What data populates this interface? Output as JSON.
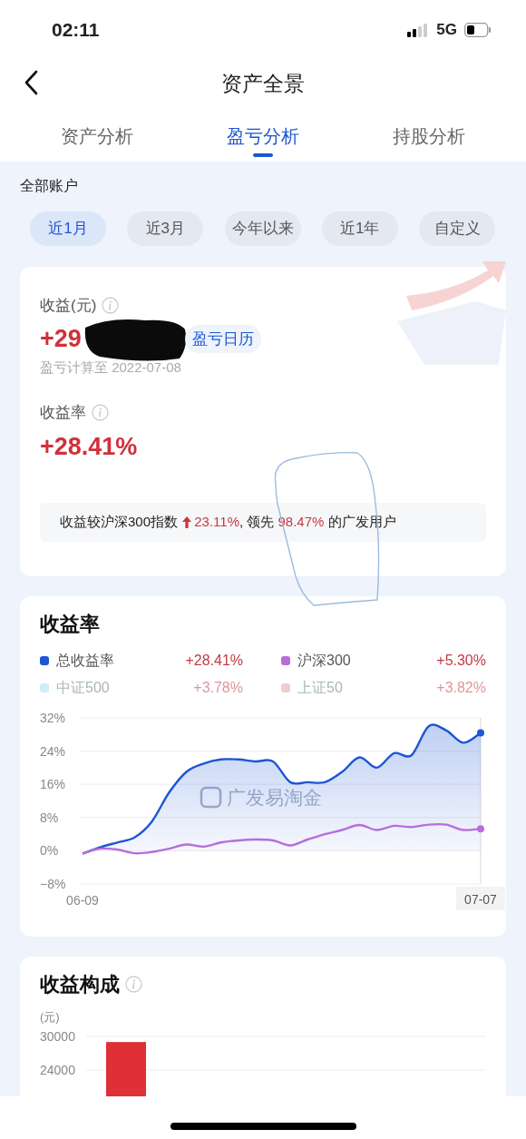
{
  "status_bar": {
    "time": "02:11",
    "network": "5G"
  },
  "header": {
    "title": "资产全景"
  },
  "tabs": [
    {
      "label": "资产分析",
      "selected": false
    },
    {
      "label": "盈亏分析",
      "selected": true
    },
    {
      "label": "持股分析",
      "selected": false
    }
  ],
  "account": "全部账户",
  "periods": [
    {
      "label": "近1月",
      "selected": true
    },
    {
      "label": "近3月",
      "selected": false
    },
    {
      "label": "今年以来",
      "selected": false
    },
    {
      "label": "近1年",
      "selected": false
    },
    {
      "label": "自定义",
      "selected": false
    }
  ],
  "summary": {
    "profit_label": "收益(元)",
    "profit_value": "+29",
    "redacted": true,
    "calendar_button": "盈亏日历",
    "as_of": "盈亏计算至 2022-07-08",
    "rate_label": "收益率",
    "rate_value": "+28.41%",
    "comparison": {
      "text_before": "收益较沪深300指数",
      "change": "23.11%",
      "text_middle": ", 领先",
      "rank": "98.47%",
      "text_after": "的广发用户"
    }
  },
  "hand_drawn_loop": true,
  "return_chart": {
    "title": "收益率",
    "legend": [
      {
        "name": "总收益率",
        "value": "+28.41%",
        "color": "#1d55d4",
        "on": true
      },
      {
        "name": "沪深300",
        "value": "+5.30%",
        "color": "#b86ddb",
        "on": true
      },
      {
        "name": "中证500",
        "value": "+3.78%",
        "color": "#cdeff3",
        "on": false
      },
      {
        "name": "上证50",
        "value": "+3.82%",
        "color": "#f3cccc",
        "on": false
      }
    ],
    "watermark": "广发易淘金",
    "chart_data": {
      "type": "line",
      "grid": true,
      "categories": [
        "06-09",
        null,
        null,
        null,
        null,
        null,
        null,
        null,
        null,
        null,
        null,
        null,
        null,
        null,
        null,
        null,
        null,
        null,
        null,
        null,
        null,
        null,
        null,
        "07-07"
      ],
      "ylim": [
        -8,
        32
      ],
      "yticks": [
        {
          "value": 32,
          "label": "32%"
        },
        {
          "value": 24,
          "label": "24%"
        },
        {
          "value": 16,
          "label": "16%"
        },
        {
          "value": 8,
          "label": "8%"
        },
        {
          "value": 0,
          "label": "0%"
        },
        {
          "value": -8,
          "label": "−8%"
        }
      ],
      "series": [
        {
          "type": "area",
          "color": "#1d55d4",
          "values": [
            -0.7,
            0.8,
            2.0,
            3.2,
            7,
            14,
            19,
            21,
            22,
            22,
            21.5,
            21.5,
            16.5,
            16.5,
            16.5,
            19,
            22.5,
            20,
            23.5,
            23,
            30,
            29,
            26,
            28.4
          ]
        },
        {
          "type": "line",
          "color": "#b86ddb",
          "values": [
            -0.7,
            0.5,
            0.3,
            -0.6,
            -0.3,
            0.5,
            1.5,
            1.0,
            2.0,
            2.5,
            2.7,
            2.5,
            1.3,
            2.7,
            4.0,
            5.0,
            6.2,
            5.0,
            6.0,
            5.7,
            6.3,
            6.3,
            5.0,
            5.3
          ]
        }
      ]
    }
  },
  "composition": {
    "title": "收益构成",
    "chart_data": {
      "type": "bar",
      "ylabel": "(元)",
      "ylim": [
        17000,
        30000
      ],
      "yticks": [
        30000,
        24000
      ],
      "values": [
        29000
      ]
    }
  }
}
